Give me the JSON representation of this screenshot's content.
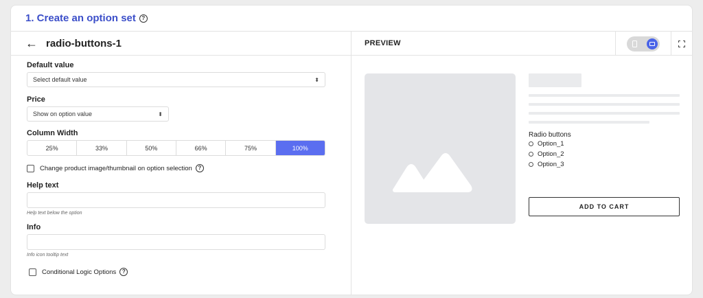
{
  "header": {
    "title": "1. Create an option set"
  },
  "editor": {
    "back_label": "←",
    "title": "radio-buttons-1",
    "default_value": {
      "label": "Default value",
      "placeholder": "Select default value"
    },
    "price": {
      "label": "Price",
      "value": "Show on option value"
    },
    "column_width": {
      "label": "Column Width",
      "options": [
        "25%",
        "33%",
        "50%",
        "66%",
        "75%",
        "100%"
      ],
      "selected": "100%"
    },
    "change_image_label": "Change product image/thumbnail on option selection",
    "help_text": {
      "label": "Help text",
      "hint": "Help text below the option",
      "value": ""
    },
    "info": {
      "label": "Info",
      "hint": "Info icon tooltip text",
      "value": ""
    },
    "conditional_logic_label": "Conditional Logic Options"
  },
  "preview": {
    "title": "PREVIEW",
    "device_selected": "desktop",
    "radio_group_title": "Radio buttons",
    "options": [
      "Option_1",
      "Option_2",
      "Option_3"
    ],
    "add_to_cart": "ADD TO CART"
  },
  "colors": {
    "accent": "#5b6ef0",
    "title": "#3c4fc9",
    "placeholder": "#e4e5e8"
  },
  "icons": [
    "help-icon",
    "back-arrow-icon",
    "mobile-icon",
    "desktop-icon",
    "expand-icon",
    "image-placeholder-icon"
  ]
}
